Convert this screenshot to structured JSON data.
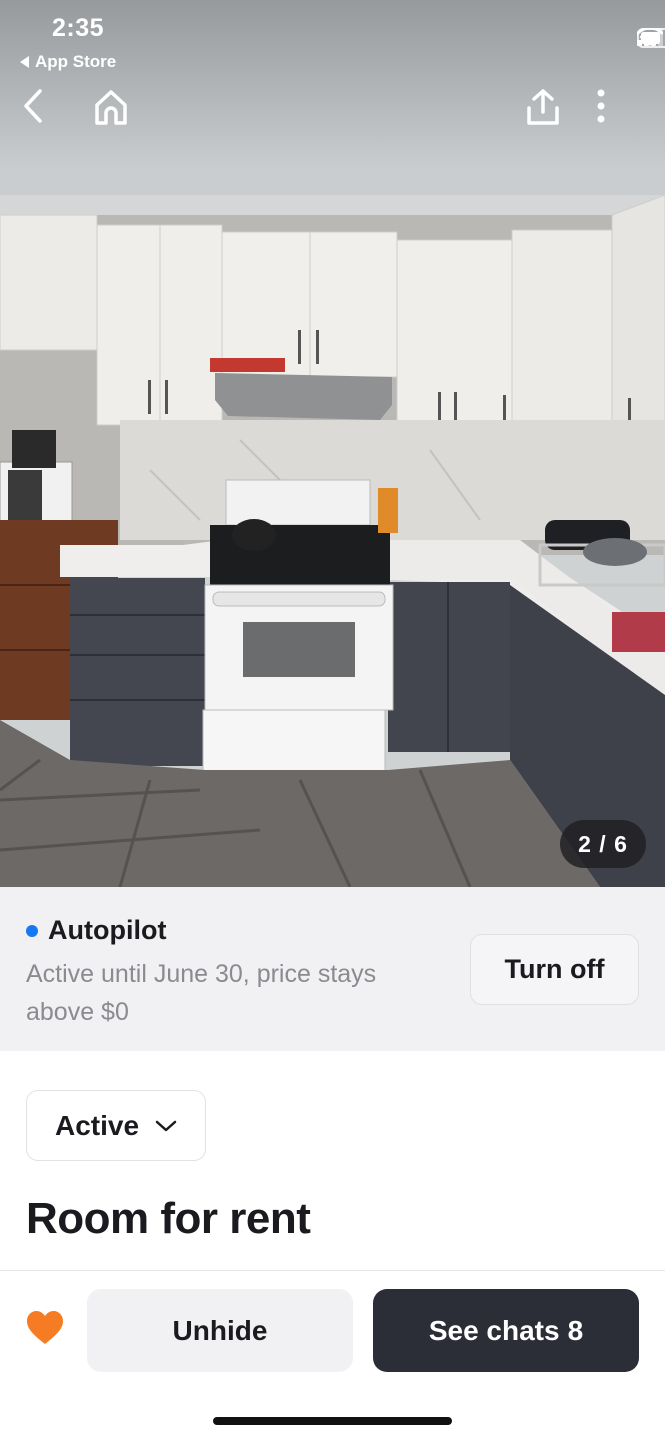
{
  "status_bar": {
    "time": "2:35",
    "back_app_label": "App Store",
    "icons": [
      "cellular-signal-icon",
      "wifi-icon",
      "battery-icon"
    ]
  },
  "top_nav": {
    "icons": [
      "back-chevron-icon",
      "home-icon",
      "share-icon",
      "more-vertical-icon"
    ]
  },
  "photo": {
    "description_icon": "listing-photo",
    "counter": "2 / 6",
    "current_index": 2,
    "total": 6
  },
  "autopilot": {
    "title": "Autopilot",
    "status_color": "#1877f2",
    "description": "Active until June 30, price stays above $0",
    "button_label": "Turn off"
  },
  "listing": {
    "status_label": "Active",
    "title": "Room for rent"
  },
  "bottom_bar": {
    "favorite_color": "#f57c22",
    "unhide_label": "Unhide",
    "chats_label": "See chats",
    "chats_count": "8"
  },
  "colors": {
    "primary_dark": "#2b2d37",
    "banner_bg": "#f1f1f3",
    "muted_text": "#8a8b90"
  }
}
